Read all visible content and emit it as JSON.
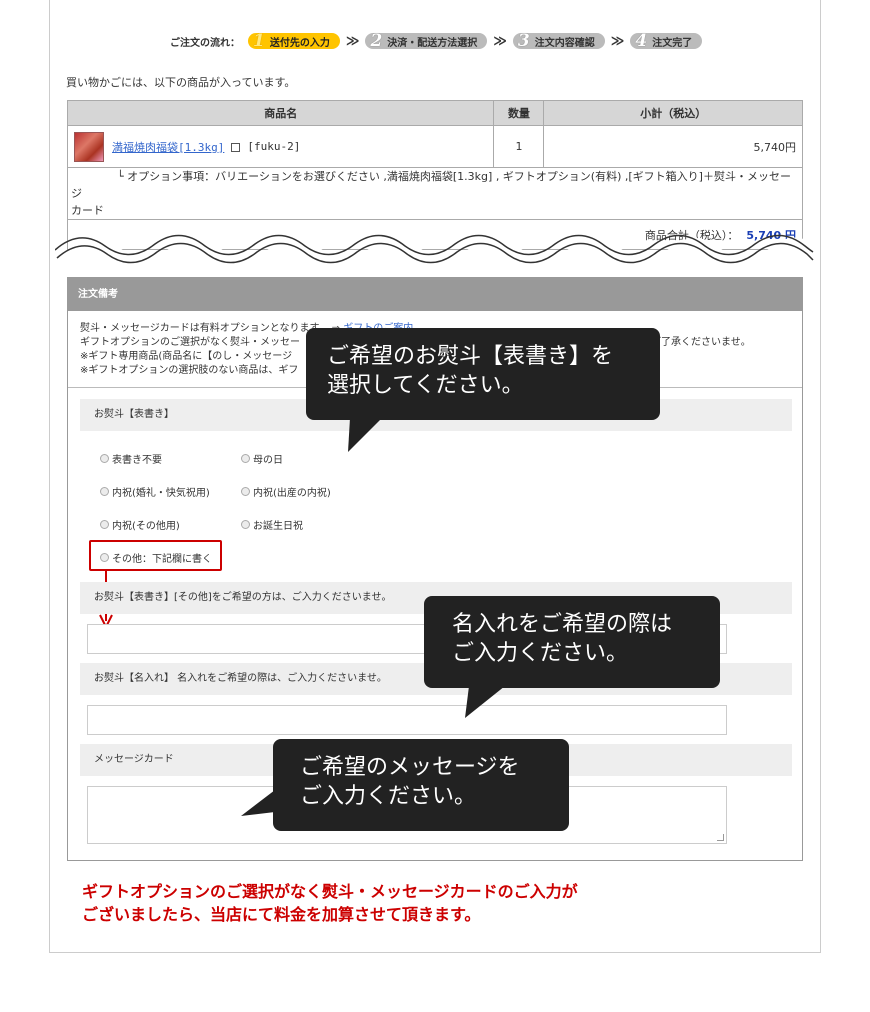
{
  "steps": {
    "lead": "ご注文の流れ：",
    "items": [
      {
        "num": "1",
        "label": "送付先の入力",
        "active": true
      },
      {
        "num": "2",
        "label": "決済・配送方法選択",
        "active": false
      },
      {
        "num": "3",
        "label": "注文内容確認",
        "active": false
      },
      {
        "num": "4",
        "label": "注文完了",
        "active": false
      }
    ],
    "separator": "≫"
  },
  "cart": {
    "intro": "買い物かごには、以下の商品が入っています。",
    "headers": [
      "商品名",
      "数量",
      "小計（税込）"
    ],
    "item": {
      "name": "満福焼肉福袋[1.3kg]",
      "sku": "[fuku-2]",
      "qty": "1",
      "subtotal": "5,740円"
    },
    "option_line1": "└ オプション事項：バリエーションをお選びください ,満福焼肉福袋[1.3kg] , ギフトオプション(有料) ,[ギフト箱入り]＋熨斗・メッセージ",
    "option_line2": "カード",
    "total_label": "商品合計（税込）：",
    "total_value": "5,740 円"
  },
  "notes": {
    "header": "注文備考",
    "line1_prefix": "熨斗・メッセージカードは有料オプションとなります。 ⇒ ",
    "gift_link": "ギフトのご案内",
    "line2": "ギフトオプションのご選択がなく熨斗・メッセー",
    "line2_tail": "ご了承くださいませ。",
    "line3": "※ギフト専用商品(商品名に【のし・メッセージ",
    "line4": "※ギフトオプションの選択肢のない商品は、ギフ"
  },
  "noshi": {
    "header": "お熨斗【表書き】",
    "options": [
      "表書き不要",
      "母の日",
      "内祝(婚礼・快気祝用)",
      "内祝(出産の内祝)",
      "内祝(その他用)",
      "お誕生日祝",
      "その他：下記欄に書く"
    ],
    "other_header": "お熨斗【表書き】[その他]をご希望の方は、ご入力くださいませ。",
    "name_header": "お熨斗【名入れ】 名入れをご希望の際は、ご入力くださいませ。",
    "card_header": "メッセージカード"
  },
  "balloons": {
    "b1_line1": "ご希望のお熨斗【表書き】を",
    "b1_line2": "選択してください。",
    "b2_line1": "名入れをご希望の際は",
    "b2_line2": "ご入力ください。",
    "b3_line1": "ご希望のメッセージを",
    "b3_line2": "ご入力ください。"
  },
  "footer_note": {
    "line1": "ギフトオプションのご選択がなく熨斗・メッセージカードのご入力が",
    "line2": "ございましたら、当店にて料金を加算させて頂きます。"
  },
  "colors": {
    "accent_red": "#cc0000",
    "step_active": "#ffc400",
    "link_blue": "#3366cc",
    "total_blue": "#1a3fb5"
  }
}
